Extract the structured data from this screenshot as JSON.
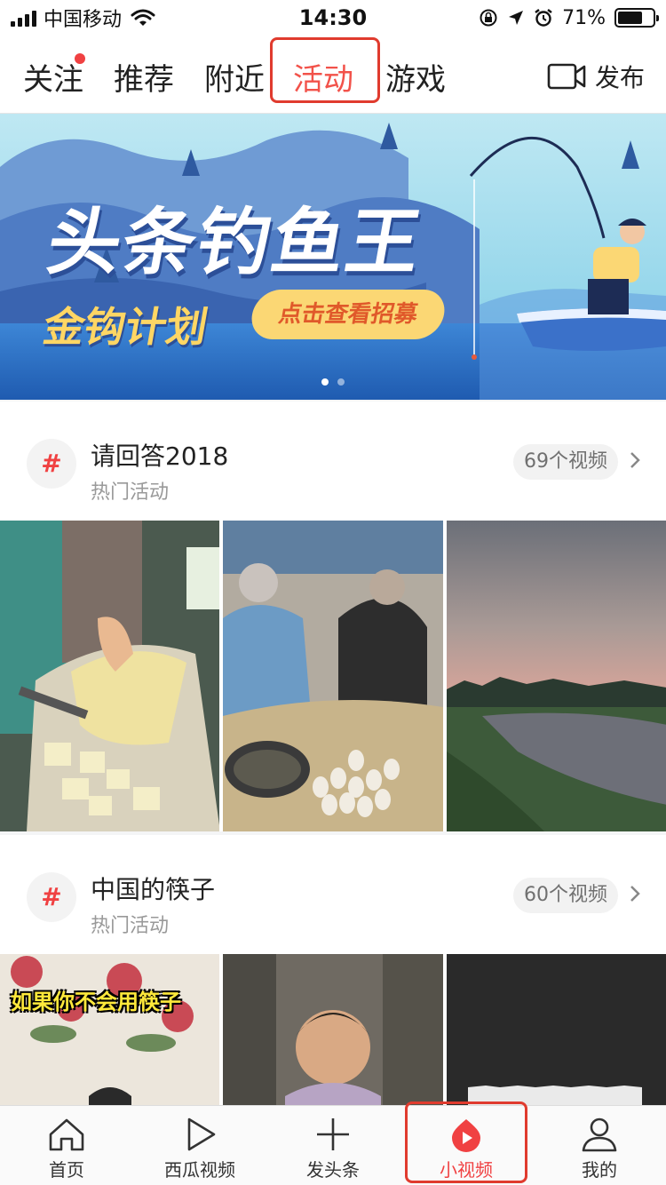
{
  "status_bar": {
    "carrier": "中国移动",
    "time": "14:30",
    "battery_percent": "71%",
    "battery_level": 0.71
  },
  "top_nav": {
    "tabs": [
      {
        "label": "关注",
        "has_badge": true
      },
      {
        "label": "推荐"
      },
      {
        "label": "附近"
      },
      {
        "label": "活动",
        "active": true
      },
      {
        "label": "游戏"
      }
    ],
    "publish_label": "发布"
  },
  "banner": {
    "title": "头条钓鱼王",
    "subtitle": "金钩计划",
    "cta": "点击查看招募",
    "page_count": 2,
    "current_page": 1
  },
  "activities": [
    {
      "title": "请回答2018",
      "subtitle": "热门活动",
      "count": "69个视频",
      "icon": "hashtag-icon"
    },
    {
      "title": "中国的筷子",
      "subtitle": "热门活动",
      "count": "60个视频",
      "icon": "hashtag-icon",
      "thumb_caption": "如果你不会用筷子"
    }
  ],
  "bottom_nav": [
    {
      "label": "首页",
      "icon": "home-icon"
    },
    {
      "label": "西瓜视频",
      "icon": "play-icon"
    },
    {
      "label": "发头条",
      "icon": "plus-icon"
    },
    {
      "label": "小视频",
      "icon": "short-video-icon",
      "active": true
    },
    {
      "label": "我的",
      "icon": "profile-icon"
    }
  ],
  "colors": {
    "accent": "#f04142",
    "highlight_box": "#e03b2e",
    "banner_sky": "#8fd3ea",
    "banner_water": "#2f6fc4"
  }
}
